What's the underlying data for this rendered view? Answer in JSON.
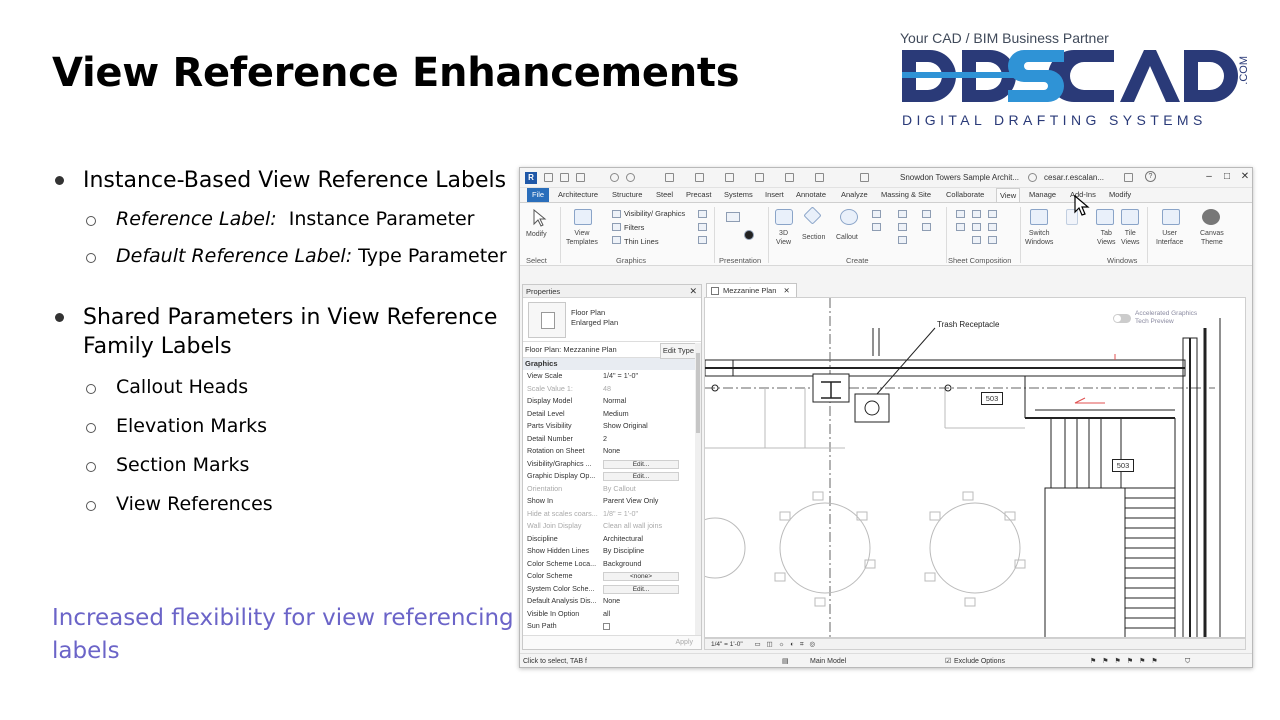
{
  "slide": {
    "title": "View Reference Enhancements",
    "bullets": [
      {
        "text": "Instance-Based View Reference Labels",
        "subs": [
          {
            "label": "Reference Label:",
            "value": "  Instance Parameter"
          },
          {
            "label": "Default Reference Label:",
            "value": " Type Parameter"
          }
        ]
      },
      {
        "text": "Shared Parameters in View Reference Family Labels",
        "subs": [
          "Callout Heads",
          "Elevation Marks",
          "Section Marks",
          "View References"
        ]
      }
    ],
    "tagline": "Increased flexibility for view referencing labels"
  },
  "logo": {
    "tagline": "Your CAD / BIM Business Partner",
    "brand": "DDSCAD",
    "dotcom": ".COM",
    "subtitle": "DIGITAL DRAFTING SYSTEMS",
    "colors": {
      "navy": "#2a3a78",
      "blue": "#2f93d6"
    }
  },
  "revit": {
    "title": "Snowdon Towers Sample Archit...",
    "user": "cesar.r.escalan...",
    "tabs": {
      "file": "File",
      "architecture": "Architecture",
      "structure": "Structure",
      "steel": "Steel",
      "precast": "Precast",
      "systems": "Systems",
      "insert": "Insert",
      "annotate": "Annotate",
      "analyze": "Analyze",
      "massing": "Massing & Site",
      "collaborate": "Collaborate",
      "view": "View",
      "manage": "Manage",
      "addins": "Add-Ins",
      "modify": "Modify"
    },
    "ribbon": {
      "modify": "Modify",
      "view_templates": "View\nTemplates",
      "visibility_graphics": "Visibility/ Graphics",
      "filters": "Filters",
      "thin_lines": "Thin  Lines",
      "three_d_view": "3D\nView",
      "section": "Section",
      "callout": "Callout",
      "switch_windows": "Switch\nWindows",
      "tab_views": "Tab\nViews",
      "tile_views": "Tile\nViews",
      "user_interface": "User\nInterface",
      "canvas_theme": "Canvas\nTheme",
      "panels": {
        "select": "Select",
        "graphics": "Graphics",
        "presentation": "Presentation",
        "create": "Create",
        "sheet_composition": "Sheet Composition",
        "windows": "Windows"
      }
    },
    "properties": {
      "header": "Properties",
      "type_name_1": "Floor Plan",
      "type_name_2": "Enlarged Plan",
      "instance": "Floor Plan: Mezzanine Plan",
      "edit_type": "Edit Type",
      "group": "Graphics",
      "rows": [
        {
          "name": "View Scale",
          "value": "1/4\" = 1'-0\"",
          "dim": false
        },
        {
          "name": "Scale Value    1:",
          "value": "48",
          "dim": true
        },
        {
          "name": "Display Model",
          "value": "Normal",
          "dim": false
        },
        {
          "name": "Detail Level",
          "value": "Medium",
          "dim": false
        },
        {
          "name": "Parts Visibility",
          "value": "Show Original",
          "dim": false
        },
        {
          "name": "Detail Number",
          "value": "2",
          "dim": false
        },
        {
          "name": "Rotation on Sheet",
          "value": "None",
          "dim": false
        },
        {
          "name": "Visibility/Graphics ...",
          "value": "Edit...",
          "button": true
        },
        {
          "name": "Graphic Display Op...",
          "value": "Edit...",
          "button": true
        },
        {
          "name": "Orientation",
          "value": "By Callout",
          "dim": true
        },
        {
          "name": "Show In",
          "value": "Parent View Only",
          "dim": false
        },
        {
          "name": "Hide at scales coars...",
          "value": "1/8\" = 1'-0\"",
          "dim": true
        },
        {
          "name": "Wall Join Display",
          "value": "Clean all wall joins",
          "dim": true
        },
        {
          "name": "Discipline",
          "value": "Architectural",
          "dim": false
        },
        {
          "name": "Show Hidden Lines",
          "value": "By Discipline",
          "dim": false
        },
        {
          "name": "Color Scheme Loca...",
          "value": "Background",
          "dim": false
        },
        {
          "name": "Color Scheme",
          "value": "<none>",
          "button": true
        },
        {
          "name": "System Color Sche...",
          "value": "Edit...",
          "button": true
        },
        {
          "name": "Default Analysis Dis...",
          "value": "None",
          "dim": false
        },
        {
          "name": "Visible In Option",
          "value": "all",
          "dim": false
        },
        {
          "name": "Sun Path",
          "value": "",
          "dim": false
        }
      ],
      "apply": "Apply"
    },
    "view_tab": "Mezzanine Plan",
    "canvas": {
      "trash_label": "Trash Receptacle",
      "accel_line1": "Accelerated Graphics",
      "accel_line2": "Tech Preview",
      "tag_a": "503",
      "tag_b": "503"
    },
    "view_scale": "1/4\" = 1'-0\"",
    "status_left": "Click to select, TAB f",
    "status_model": "Main Model",
    "status_exclude": "Exclude Options"
  }
}
